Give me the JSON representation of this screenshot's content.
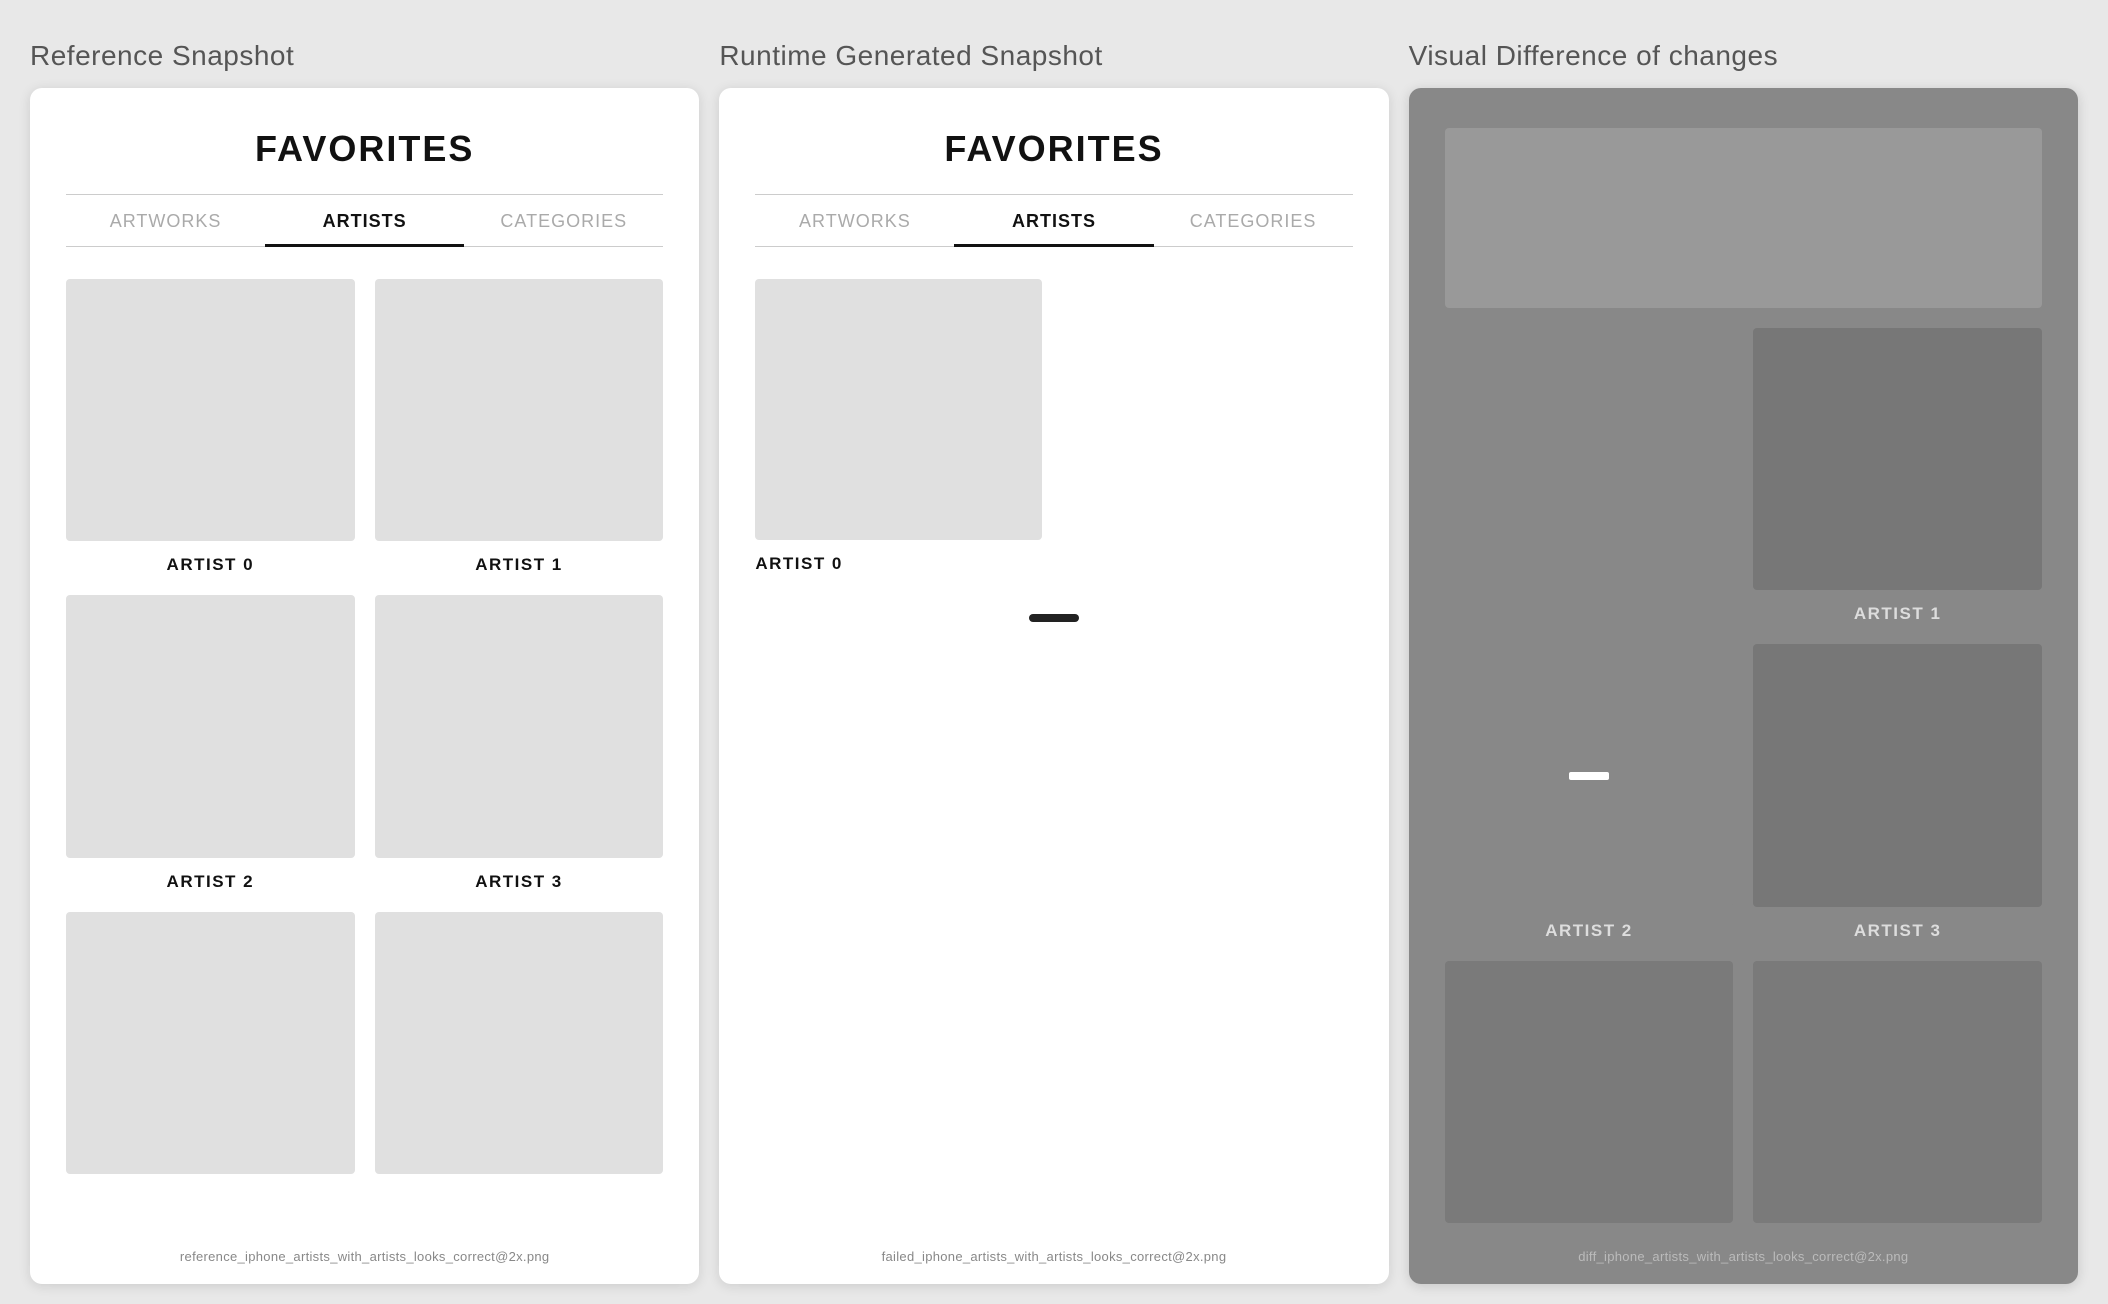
{
  "panels": [
    {
      "id": "reference",
      "title": "Reference Snapshot",
      "caption": "reference_iphone_artists_with_artists_looks_correct@2x.png",
      "type": "reference",
      "favorites_title": "FAVORITES",
      "tabs": [
        {
          "label": "ARTWORKS",
          "active": false
        },
        {
          "label": "ARTISTS",
          "active": true
        },
        {
          "label": "CATEGORIES",
          "active": false
        }
      ],
      "artists": [
        {
          "name": "ARTIST 0"
        },
        {
          "name": "ARTIST 1"
        },
        {
          "name": "ARTIST 2"
        },
        {
          "name": "ARTIST 3"
        },
        {
          "name": ""
        },
        {
          "name": ""
        }
      ]
    },
    {
      "id": "runtime",
      "title": "Runtime Generated Snapshot",
      "caption": "failed_iphone_artists_with_artists_looks_correct@2x.png",
      "type": "runtime",
      "favorites_title": "FAVORITES",
      "tabs": [
        {
          "label": "ARTWORKS",
          "active": false
        },
        {
          "label": "ARTISTS",
          "active": true
        },
        {
          "label": "CATEGORIES",
          "active": false
        }
      ],
      "artists": [
        {
          "name": "ARTIST 0"
        }
      ]
    },
    {
      "id": "diff",
      "title": "Visual Difference of changes",
      "caption": "diff_iphone_artists_with_artists_looks_correct@2x.png",
      "type": "diff",
      "artists": [
        {
          "name": "ARTIST 1",
          "position": "right"
        },
        {
          "name": "ARTIST 2",
          "position": "left"
        },
        {
          "name": "ARTIST 3",
          "position": "right"
        }
      ]
    }
  ]
}
